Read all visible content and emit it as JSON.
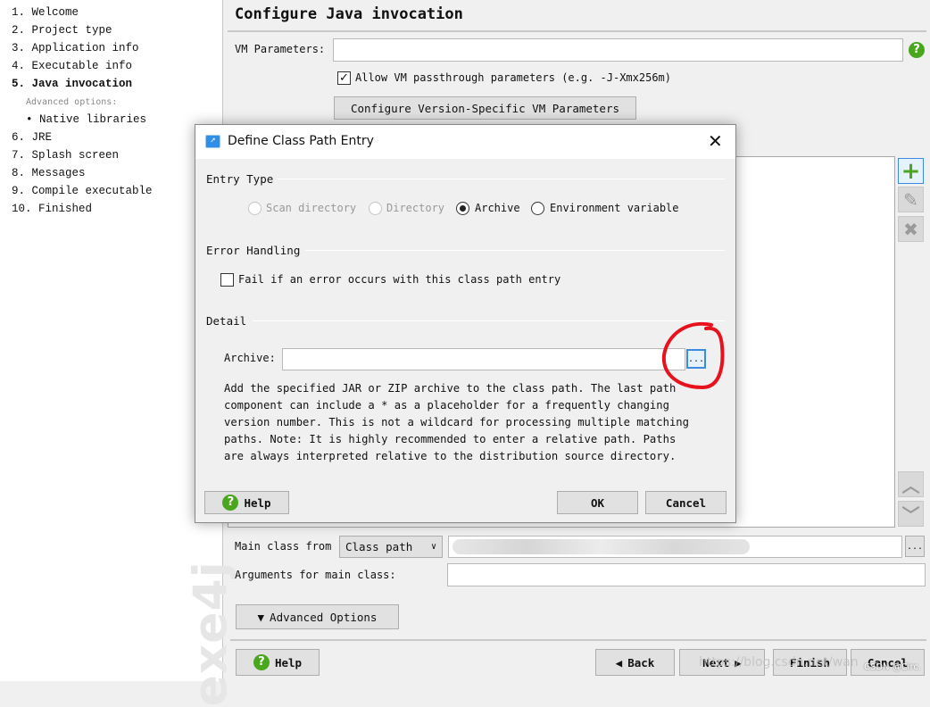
{
  "sidebar": {
    "steps": [
      "1. Welcome",
      "2. Project type",
      "3. Application info",
      "4. Executable info",
      "5. Java invocation",
      "6. JRE",
      "7. Splash screen",
      "8. Messages",
      "9. Compile executable",
      "10. Finished"
    ],
    "advanced_label": "Advanced options:",
    "sub_item": "• Native libraries",
    "active_step": "5. Java invocation",
    "watermark": "exe4j"
  },
  "main": {
    "title": "Configure Java invocation",
    "vm_label": "VM Parameters:",
    "vm_value": "",
    "passthrough_label": "Allow VM passthrough parameters (e.g. -J-Xmx256m)",
    "passthrough_checked": true,
    "version_button": "Configure Version-Specific VM Parameters",
    "main_class_label": "Main class from",
    "main_class_source": "Class path",
    "main_class_value": "",
    "browse_label": "...",
    "args_label": "Arguments for main class:",
    "args_value": "",
    "advanced_button": "Advanced Options",
    "toolbar_icons": [
      "plus-icon",
      "edit-icon",
      "delete-icon",
      "up-arrow-icon",
      "down-arrow-icon"
    ]
  },
  "footer": {
    "help": "Help",
    "back": "Back",
    "next": "Next",
    "finish": "Finish",
    "cancel": "Cancel"
  },
  "dialog": {
    "title": "Define Class Path Entry",
    "entry_type_label": "Entry Type",
    "options": [
      {
        "label": "Scan directory",
        "enabled": false,
        "selected": false
      },
      {
        "label": "Directory",
        "enabled": false,
        "selected": false
      },
      {
        "label": "Archive",
        "enabled": true,
        "selected": true
      },
      {
        "label": "Environment variable",
        "enabled": true,
        "selected": false
      }
    ],
    "error_label": "Error Handling",
    "fail_label": "Fail if an error occurs with this class path entry",
    "fail_checked": false,
    "detail_label": "Detail",
    "archive_label": "Archive:",
    "archive_value": "",
    "browse_label": "...",
    "description": [
      "Add the specified JAR or ZIP archive to the class path. The last path",
      "component can include a * as a placeholder for a frequently changing",
      "version number. This is not a wildcard for processing multiple matching",
      "paths. Note: It is highly recommended to enter a relative path. Paths",
      "are always interpreted relative to the distribution source directory."
    ],
    "help": "Help",
    "ok": "OK",
    "cancel": "Cancel"
  },
  "overlay": {
    "url_watermark": "https://blog.csdn.net/wan",
    "csdn_watermark": "CSDN @Circ.",
    "annotation_color": "#e8121c"
  },
  "colors": {
    "accent_green": "#4aa51f",
    "focus_blue": "#3c8be0"
  }
}
